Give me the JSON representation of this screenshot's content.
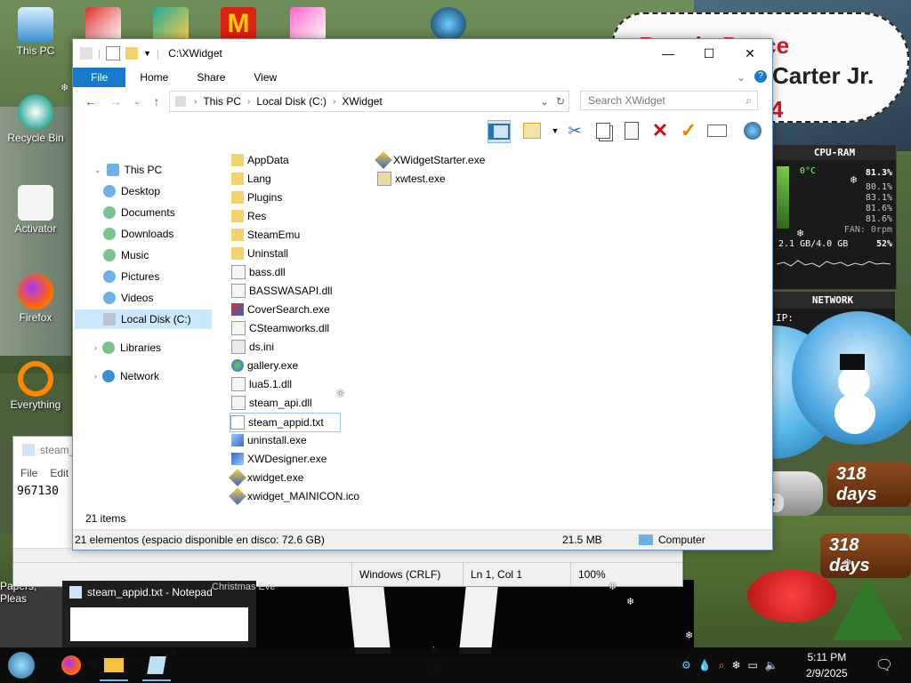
{
  "desktop": {
    "icons": [
      {
        "label": "This PC"
      },
      {
        "label": "Recycle Bin"
      },
      {
        "label": "Activator"
      },
      {
        "label": "Firefox"
      },
      {
        "label": "Everything"
      },
      {
        "label": "Papers, Pleas"
      }
    ],
    "sign": {
      "line1": "Rest in Peace",
      "line2": "Carter Jr.",
      "line3": "4"
    },
    "cpu_widget": {
      "title": "CPU-RAM",
      "temp": "0°C",
      "cpu_total": "81.3%",
      "cores": [
        "80.1%",
        "83.1%",
        "81.6%",
        "81.6%"
      ],
      "fan": "FAN: 0rpm",
      "ram": "2.1 GB/4.0 GB",
      "ram_pct": "52%"
    },
    "network_widget": {
      "title": "NETWORK",
      "ip_label": "IP:"
    },
    "days_badges": [
      "318 days",
      "318 days",
      "318"
    ]
  },
  "notepad": {
    "title": "steam_",
    "menu": [
      "File",
      "Edit"
    ],
    "content": "967130",
    "status": {
      "encoding": "Windows (CRLF)",
      "position": "Ln 1, Col 1",
      "zoom": "100%"
    }
  },
  "explorer": {
    "title": "C:\\XWidget",
    "tabs": [
      "File",
      "Home",
      "Share",
      "View"
    ],
    "breadcrumb": [
      "This PC",
      "Local Disk (C:)",
      "XWidget"
    ],
    "search_placeholder": "Search XWidget",
    "nav": [
      {
        "label": "This PC"
      },
      {
        "label": "Desktop"
      },
      {
        "label": "Documents"
      },
      {
        "label": "Downloads"
      },
      {
        "label": "Music"
      },
      {
        "label": "Pictures"
      },
      {
        "label": "Videos"
      },
      {
        "label": "Local Disk (C:)"
      },
      {
        "label": "Libraries"
      },
      {
        "label": "Network"
      }
    ],
    "files_col1": [
      {
        "name": "AppData",
        "icon": "folder-icon"
      },
      {
        "name": "Lang",
        "icon": "folder-icon"
      },
      {
        "name": "Plugins",
        "icon": "folder-icon"
      },
      {
        "name": "Res",
        "icon": "folder-icon"
      },
      {
        "name": "SteamEmu",
        "icon": "folder-icon"
      },
      {
        "name": "Uninstall",
        "icon": "folder-icon"
      },
      {
        "name": "bass.dll",
        "icon": "dll-icon"
      },
      {
        "name": "BASSWASAPI.dll",
        "icon": "dll-icon"
      },
      {
        "name": "CoverSearch.exe",
        "icon": "app-icon"
      },
      {
        "name": "CSteamworks.dll",
        "icon": "dll-icon"
      },
      {
        "name": "ds.ini",
        "icon": "ini-icon"
      },
      {
        "name": "gallery.exe",
        "icon": "app-icon"
      },
      {
        "name": "lua5.1.dll",
        "icon": "dll-icon"
      },
      {
        "name": "steam_api.dll",
        "icon": "dll-icon"
      },
      {
        "name": "steam_appid.txt",
        "icon": "txt-icon"
      },
      {
        "name": "uninstall.exe",
        "icon": "app-icon"
      },
      {
        "name": "XWDesigner.exe",
        "icon": "app-icon"
      },
      {
        "name": "xwidget.exe",
        "icon": "app-icon"
      },
      {
        "name": "xwidget_MAINICON.ico",
        "icon": "ico-icon"
      }
    ],
    "files_col2": [
      {
        "name": "XWidgetStarter.exe",
        "icon": "app-icon"
      },
      {
        "name": "xwtest.exe",
        "icon": "app-icon"
      }
    ],
    "item_count": "21 items",
    "status_detail": "21 elementos (espacio disponible en disco: 72.6 GB)",
    "status_size": "21.5 MB",
    "status_location": "Computer"
  },
  "taskbar": {
    "preview_title": "steam_appid.txt - Notepad",
    "behind_text": "Christmas Eve",
    "clock_time": "5:11 PM",
    "clock_date": "2/9/2025"
  }
}
